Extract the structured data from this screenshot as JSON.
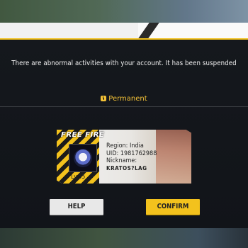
{
  "notice": {
    "message": "There are abnormal activities with your account. It has been suspended",
    "duration_label": "Permanent"
  },
  "card": {
    "logo_text": "FREE FIRE",
    "region": "Region: India",
    "uid": "UID: 1981762988",
    "nickname_label": "Nickname:",
    "nickname_value": "KRATOS?LAG",
    "level": "Lv.55"
  },
  "buttons": {
    "help": "HELP",
    "confirm": "CONFIRM"
  },
  "colors": {
    "accent": "#f3c21d",
    "background": "#111419"
  }
}
